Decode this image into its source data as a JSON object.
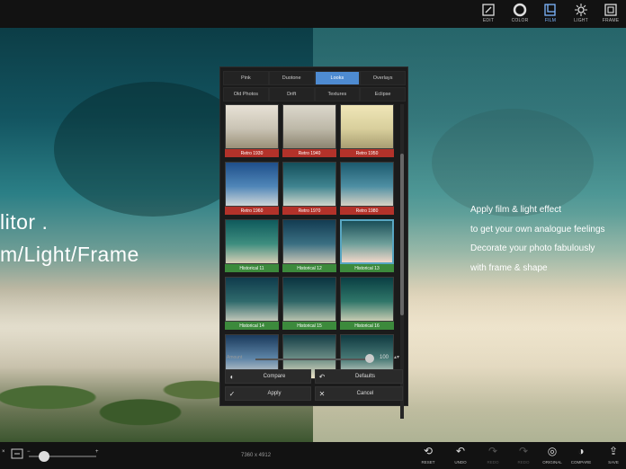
{
  "toolbar": {
    "items": [
      {
        "label": "EDIT",
        "icon": "edit-icon"
      },
      {
        "label": "COLOR",
        "icon": "color-icon"
      },
      {
        "label": "FILM",
        "icon": "film-icon"
      },
      {
        "label": "LIGHT",
        "icon": "light-icon"
      },
      {
        "label": "FRAME",
        "icon": "frame-icon"
      }
    ],
    "active": "FILM",
    "accent": "#7fb7ff"
  },
  "canvas": {
    "hero_line1": "litor .",
    "hero_line2": "m/Light/Frame",
    "pitch": [
      "Apply film & light effect",
      "to get your own analogue feelings",
      "Decorate your photo fabulously",
      "with frame & shape"
    ]
  },
  "film_panel": {
    "tabs_row1": [
      "Pink",
      "Duotone",
      "Looks",
      "Overlays"
    ],
    "tabs_row2": [
      "Old Photos",
      "Drift",
      "Textures",
      "Eclipse"
    ],
    "active_tab": "Looks",
    "presets": [
      {
        "name": "Retro 1930",
        "tag": "#b3322a"
      },
      {
        "name": "Retro 1940",
        "tag": "#b3322a"
      },
      {
        "name": "Retro 1950",
        "tag": "#b3322a"
      },
      {
        "name": "Retro 1960",
        "tag": "#b3322a"
      },
      {
        "name": "Retro 1970",
        "tag": "#b3322a"
      },
      {
        "name": "Retro 1980",
        "tag": "#b3322a"
      },
      {
        "name": "Historical 11",
        "tag": "#3c8a3c"
      },
      {
        "name": "Historical 12",
        "tag": "#3c8a3c"
      },
      {
        "name": "Historical 13",
        "tag": "#3c8a3c"
      },
      {
        "name": "Historical 14",
        "tag": "#3c8a3c"
      },
      {
        "name": "Historical 15",
        "tag": "#3c8a3c"
      },
      {
        "name": "Historical 16",
        "tag": "#3c8a3c"
      },
      {
        "name": "",
        "tag": ""
      },
      {
        "name": "",
        "tag": ""
      },
      {
        "name": "",
        "tag": ""
      }
    ],
    "selected": "Historical 13",
    "amount_label": "Amount",
    "amount_value": "100",
    "amount_fraction": 1.0,
    "compare_label": "Compare",
    "defaults_label": "Defaults",
    "apply_label": "Apply",
    "cancel_label": "Cancel"
  },
  "bottombar": {
    "dimensions": "7360 x 4912",
    "tools": [
      {
        "label": "RESET",
        "icon": "reset-icon",
        "enabled": true
      },
      {
        "label": "UNDO",
        "icon": "undo-icon",
        "enabled": true
      },
      {
        "label": "REDO",
        "icon": "redo-icon",
        "enabled": false
      },
      {
        "label": "REDO",
        "icon": "redo-icon",
        "enabled": false
      },
      {
        "label": "ORIGINAL",
        "icon": "original-icon",
        "enabled": true
      },
      {
        "label": "COMPARE",
        "icon": "compare-icon",
        "enabled": true
      },
      {
        "label": "SAVE",
        "icon": "save-icon",
        "enabled": true
      }
    ]
  }
}
